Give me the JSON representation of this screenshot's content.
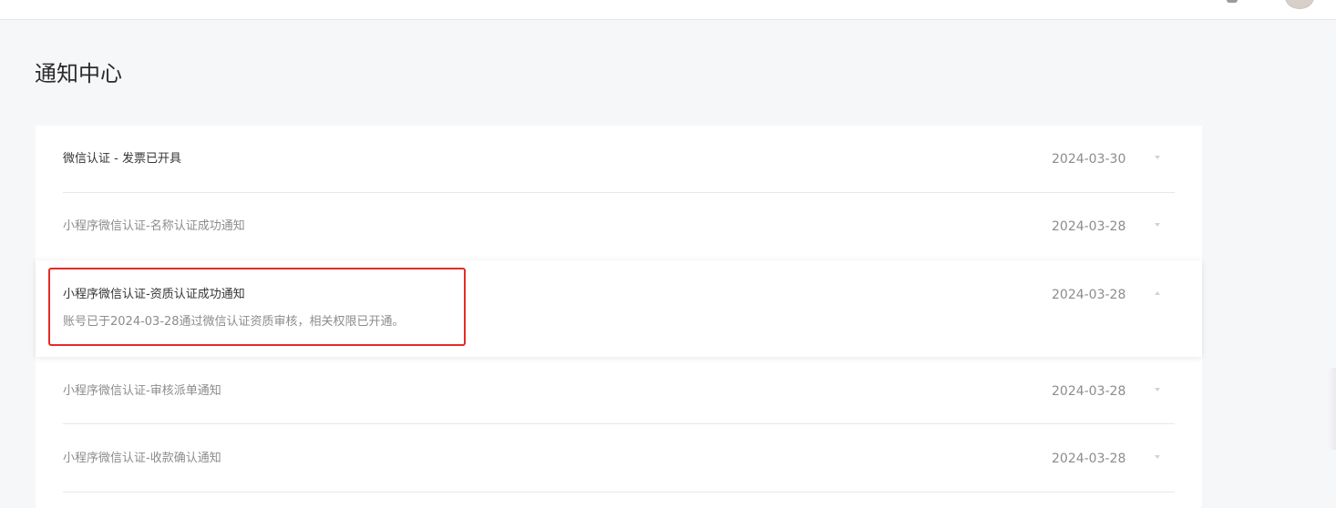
{
  "page": {
    "title": "通知中心"
  },
  "notifications": [
    {
      "title": "微信认证 - 发票已开具",
      "date": "2024-03-30",
      "state": "unread",
      "expanded": false
    },
    {
      "title": "小程序微信认证-名称认证成功通知",
      "date": "2024-03-28",
      "state": "read",
      "expanded": false
    },
    {
      "title": "小程序微信认证-资质认证成功通知",
      "date": "2024-03-28",
      "state": "unread",
      "expanded": true,
      "detail": "账号已于2024-03-28通过微信认证资质审核，相关权限已开通。"
    },
    {
      "title": "小程序微信认证-审核派单通知",
      "date": "2024-03-28",
      "state": "read",
      "expanded": false
    },
    {
      "title": "小程序微信认证-收款确认通知",
      "date": "2024-03-28",
      "state": "read",
      "expanded": false
    }
  ],
  "icons": {
    "collapsed": "chevron-down-icon",
    "expanded": "chevron-up-icon"
  },
  "colors": {
    "highlight_box": "#e52b28",
    "background": "#f6f7f9",
    "read_text": "#8c8c8c",
    "unread_text": "#353535"
  }
}
